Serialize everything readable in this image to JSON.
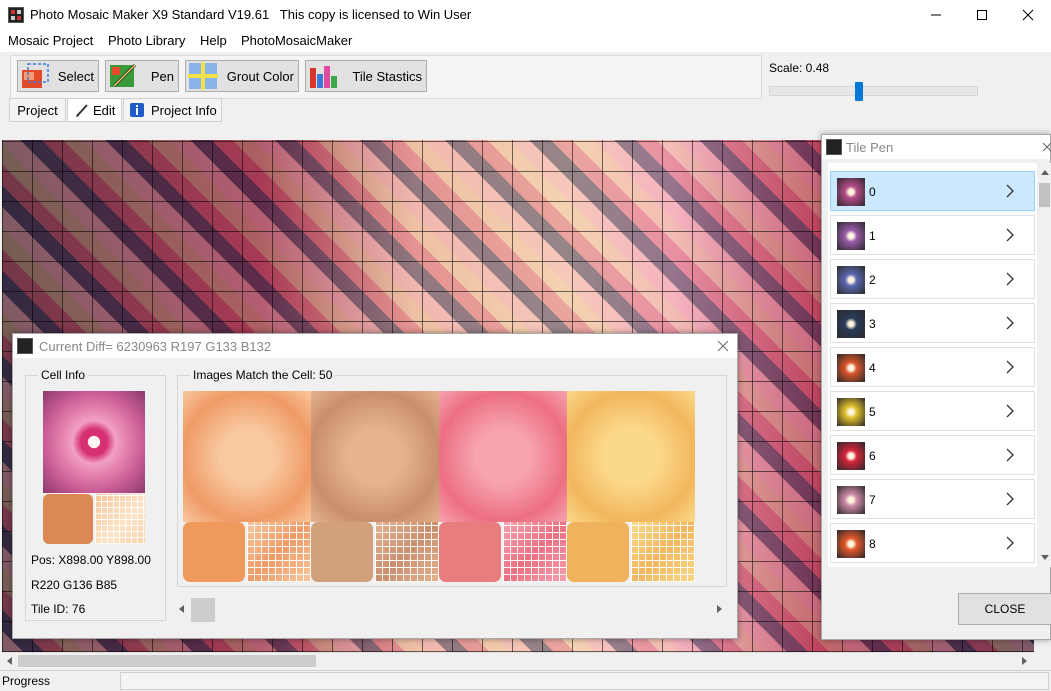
{
  "window": {
    "title": "Photo Mosaic Maker X9 Standard V19.61   This copy is licensed to Win User"
  },
  "menu": [
    "Mosaic Project",
    "Photo Library",
    "Help",
    "PhotoMosaicMaker"
  ],
  "toolbar": {
    "select_label": "Select",
    "pen_label": "Pen",
    "grout_label": "Grout Color",
    "stats_label": "Tile Stastics"
  },
  "tabs": {
    "project": "Project",
    "edit": "Edit",
    "project_info": "Project Info"
  },
  "scale": {
    "label": "Scale: 0.48",
    "value": 0.48,
    "slider_fraction": 0.43
  },
  "diff_dialog": {
    "title": "Current Diff= 6230963 R197 G133 B132",
    "cell_info": {
      "caption": "Cell Info",
      "pos": "Pos: X898.00 Y898.00",
      "rgb": "R220 G136 B85",
      "tile_id": "Tile ID: 76",
      "swatch_color": "#dc8855"
    },
    "matches": {
      "caption": "Images Match the Cell: 50",
      "items": [
        {
          "swatch": "#f0995c",
          "img_a": "#f8c89e",
          "img_b": "#f09a66"
        },
        {
          "swatch": "#d2a07c",
          "img_a": "#e6b290",
          "img_b": "#c98f6c"
        },
        {
          "swatch": "#e97c7c",
          "img_a": "#f7a3b0",
          "img_b": "#ec6f80"
        },
        {
          "swatch": "#f0b25c",
          "img_a": "#fbd98a",
          "img_b": "#f2b65e"
        }
      ]
    }
  },
  "tile_pen": {
    "title": "Tile Pen",
    "items": [
      {
        "num": "0",
        "color": "#b54a8a",
        "selected": true
      },
      {
        "num": "1",
        "color": "#9a5aa8"
      },
      {
        "num": "2",
        "color": "#5a68b0"
      },
      {
        "num": "3",
        "color": "#2a3a5a"
      },
      {
        "num": "4",
        "color": "#d8542a"
      },
      {
        "num": "5",
        "color": "#e0c02a"
      },
      {
        "num": "6",
        "color": "#d4233a"
      },
      {
        "num": "7",
        "color": "#d08aa8"
      },
      {
        "num": "8",
        "color": "#e2582a"
      }
    ],
    "close_label": "CLOSE"
  },
  "status": {
    "progress_label": "Progress"
  }
}
